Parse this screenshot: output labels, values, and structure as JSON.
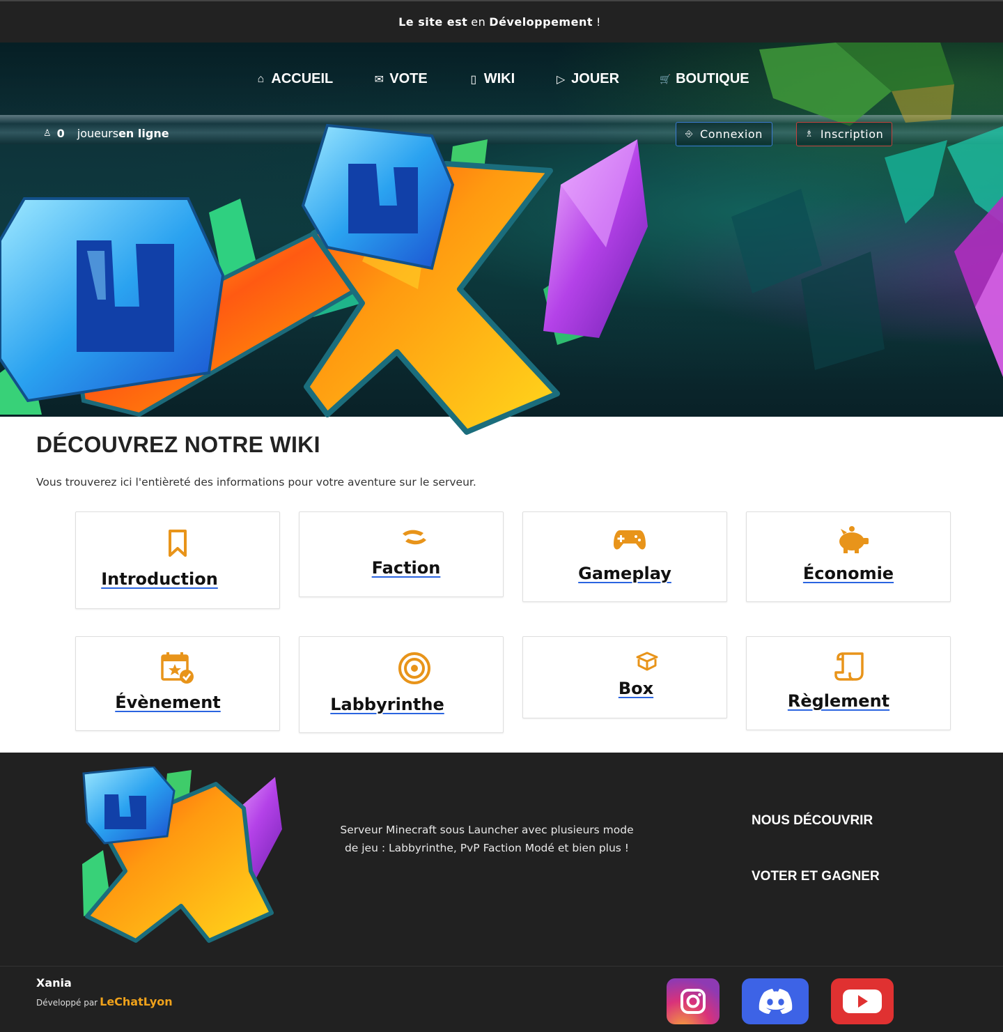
{
  "announcement": {
    "prefix": "Le site est",
    "middle": "en",
    "emphasis": "Développement",
    "suffix": "!"
  },
  "nav": {
    "items": [
      {
        "label": "ACCUEIL",
        "icon": "home-icon",
        "glyph": "⌂"
      },
      {
        "label": "VOTE",
        "icon": "envelope-icon",
        "glyph": "✉"
      },
      {
        "label": "WIKI",
        "icon": "page-icon",
        "glyph": "▯"
      },
      {
        "label": "JOUER",
        "icon": "play-icon",
        "glyph": "▷"
      },
      {
        "label": "BOUTIQUE",
        "icon": "cart-icon",
        "glyph": "🛒"
      }
    ]
  },
  "online": {
    "count": "0",
    "label_light": "joueurs",
    "label_bold": "en ligne"
  },
  "auth": {
    "login": "Connexion",
    "register": "Inscription"
  },
  "main": {
    "title": "DÉCOUVREZ NOTRE WIKI",
    "subtitle": "Vous trouverez ici l'entièreté des informations pour votre aventure sur le serveur."
  },
  "cards": [
    {
      "label": "Introduction",
      "icon": "bookmark-icon"
    },
    {
      "label": "Faction",
      "icon": "handshake-icon"
    },
    {
      "label": "Gameplay",
      "icon": "gamepad-icon"
    },
    {
      "label": "Économie",
      "icon": "piggy-bank-icon"
    },
    {
      "label": "Évènement",
      "icon": "calendar-star-icon"
    },
    {
      "label": "Labbyrinthe",
      "icon": "target-icon"
    },
    {
      "label": "Box",
      "icon": "box-icon"
    },
    {
      "label": "Règlement",
      "icon": "scroll-icon"
    }
  ],
  "footer": {
    "description": "Serveur Minecraft sous Launcher avec plusieurs mode de jeu : Labbyrinthe, PvP Faction Modé et bien plus !",
    "links": [
      "NOUS DÉCOUVRIR",
      "VOTER ET GAGNER"
    ],
    "brand": "Xania",
    "dev_prefix": "Développé par",
    "dev_author": "LeChatLyon",
    "socials": [
      "instagram-icon",
      "discord-icon",
      "youtube-icon"
    ]
  },
  "colors": {
    "accent": "#e8941a",
    "underline": "#2a64e0",
    "footer_bg": "#212121",
    "topbar_bg": "#222222",
    "login_border": "#3b7bd4",
    "register_border": "#c8413d",
    "author": "#f0a21b"
  }
}
